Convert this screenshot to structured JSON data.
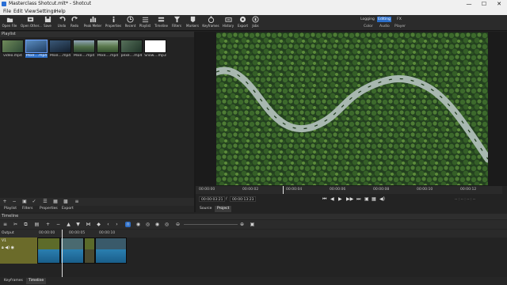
{
  "window": {
    "title": "Masterclass Shotcut.mlt* - Shotcut",
    "minimize": "—",
    "maximize": "☐",
    "close": "✕"
  },
  "menu": [
    "File",
    "Edit",
    "View",
    "Settings",
    "Help"
  ],
  "toolbar": {
    "buttons": [
      "Open File",
      "Open Other...",
      "Save",
      "Undo",
      "Redo",
      "Peak Meter",
      "Properties",
      "Recent",
      "Playlist",
      "Timeline",
      "Filters",
      "Markers",
      "Keyframes",
      "History",
      "Export",
      "Jobs"
    ],
    "layouts": [
      "Logging",
      "Editing",
      "FX"
    ],
    "active_layout": "Editing",
    "sub_layouts": [
      "Color",
      "Audio",
      "Player"
    ]
  },
  "playlist": {
    "title": "Playlist",
    "items": [
      {
        "name": "video.mp4",
        "color": "#4d6a4a"
      },
      {
        "name": "Pexe....mp4",
        "color": "#3a6a9a"
      },
      {
        "name": "Pexe....mp4",
        "color": "#2a3e58"
      },
      {
        "name": "Pexe....mp4",
        "color": "#4a6a4a"
      },
      {
        "name": "Pexe....mp4",
        "color": "#5a7a4a"
      },
      {
        "name": "pexe....mp4",
        "color": "#3e5a44"
      },
      {
        "name": "Snow....mp3",
        "color": "#ffffff"
      }
    ],
    "selected_index": 1,
    "tabs": [
      "Playlist",
      "Filters",
      "Properties",
      "Export"
    ]
  },
  "player": {
    "ruler_labels": [
      "00:00:00",
      "00:00:02",
      "00:00:04",
      "00:00:06",
      "00:00:08",
      "00:00:10",
      "00:00:12"
    ],
    "current_time": "00:00:03:21",
    "duration": "00:00:13:23",
    "in_out": "-- : -- : -- : --",
    "tabs": [
      "Source",
      "Project"
    ],
    "active_tab": "Project"
  },
  "timeline": {
    "title": "Timeline",
    "header": "Output",
    "track_name": "V1",
    "ruler_labels": [
      "00:00:00",
      "00:00:05",
      "00:00:10"
    ],
    "bottom_tabs": [
      "Keyframes",
      "Timeline"
    ],
    "active_bottom_tab": "Timeline"
  }
}
